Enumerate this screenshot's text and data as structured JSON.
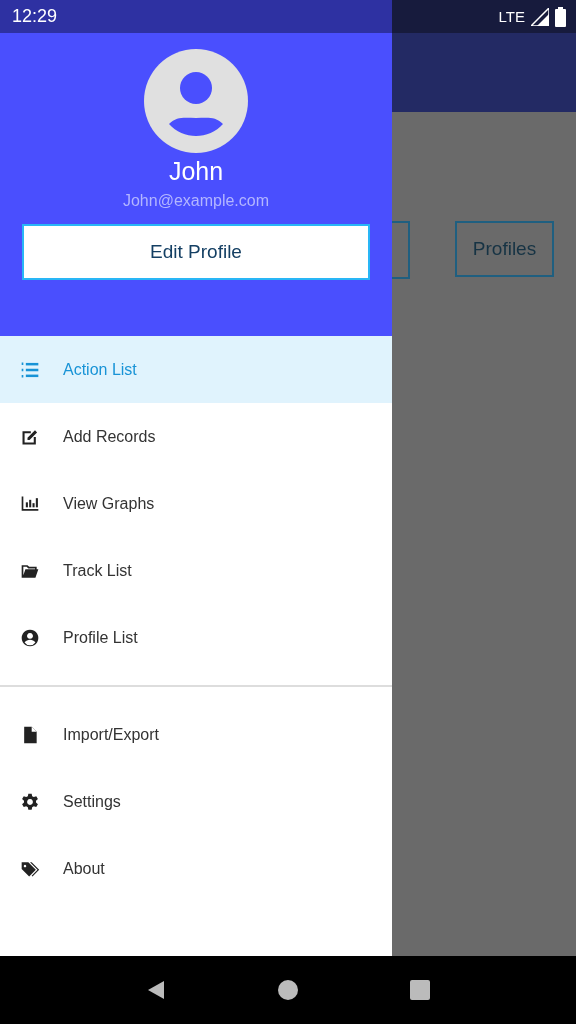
{
  "status_bar": {
    "time": "12:29",
    "network": "LTE"
  },
  "drawer": {
    "header": {
      "name": "John",
      "email": "John@example.com",
      "button": "Edit Profile"
    },
    "sections": [
      {
        "items": [
          {
            "label": "Action List",
            "selected": true
          },
          {
            "label": "Add Records",
            "selected": false
          },
          {
            "label": "View Graphs",
            "selected": false
          },
          {
            "label": "Track List",
            "selected": false
          },
          {
            "label": "Profile List",
            "selected": false
          }
        ]
      },
      {
        "items": [
          {
            "label": "Import/Export",
            "selected": false
          },
          {
            "label": "Settings",
            "selected": false
          },
          {
            "label": "About",
            "selected": false
          }
        ]
      }
    ]
  },
  "background": {
    "buttons": [
      "Profiles"
    ]
  }
}
